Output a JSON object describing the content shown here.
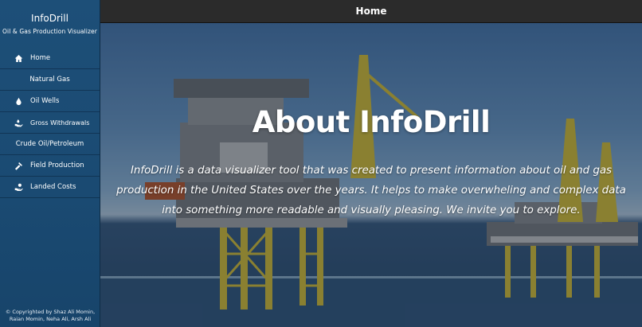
{
  "sidebar": {
    "brand": "InfoDrill",
    "subtitle": "Oil & Gas Production Visualizer",
    "items": [
      {
        "label": "Home",
        "icon": "home-icon",
        "type": "link"
      },
      {
        "label": "Natural Gas",
        "type": "section"
      },
      {
        "label": "Oil Wells",
        "icon": "droplet-icon",
        "type": "link"
      },
      {
        "label": "Gross Withdrawals",
        "icon": "hand-withdraw-icon",
        "type": "link"
      },
      {
        "label": "Crude Oil/Petroleum",
        "type": "section"
      },
      {
        "label": "Field Production",
        "icon": "hammer-icon",
        "type": "link"
      },
      {
        "label": "Landed Costs",
        "icon": "money-hand-icon",
        "type": "link"
      }
    ],
    "copyright_line1": "© Copyrighted by Shaz Ali Momin,",
    "copyright_line2": "Raian Momin, Neha Ali, Arsh Ali"
  },
  "header": {
    "title": "Home"
  },
  "hero": {
    "headline": "About InfoDrill",
    "description": "InfoDrill is a data visualizer tool that was created to present information about oil and gas production in the United States over the years. It helps to make overwheling and complex data into something more readable and visually pleasing. We invite you to explore."
  },
  "colors": {
    "sidebar": "#1a4a72",
    "topbar": "#2b2b2b",
    "text": "#ffffff"
  }
}
